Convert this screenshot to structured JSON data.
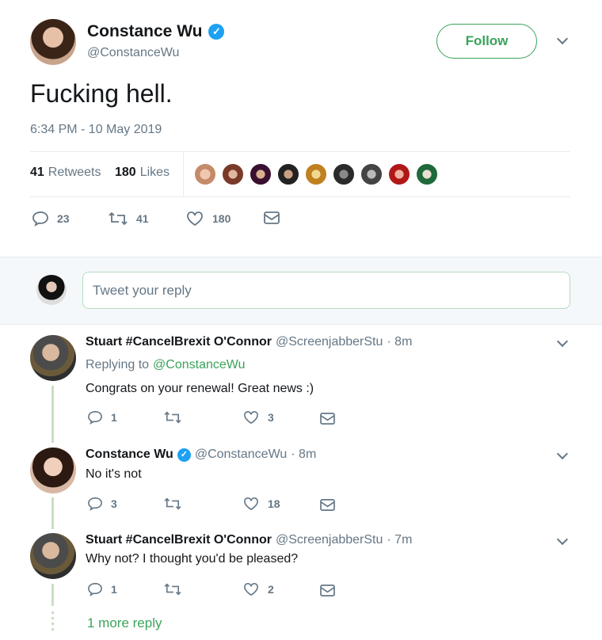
{
  "main_tweet": {
    "author_name": "Constance Wu",
    "author_handle": "@ConstanceWu",
    "follow_label": "Follow",
    "text": "Fucking hell.",
    "timestamp": "6:34 PM - 10 May 2019",
    "retweets_count": "41",
    "retweets_label": "Retweets",
    "likes_count": "180",
    "likes_label": "Likes",
    "actions": {
      "replies": "23",
      "retweets": "41",
      "likes": "180"
    }
  },
  "reply_box": {
    "placeholder": "Tweet your reply"
  },
  "replies": [
    {
      "name": "Stuart #CancelBrexit O'Connor",
      "handle": "@ScreenjabberStu",
      "time": "· 8m",
      "replying_prefix": "Replying to",
      "replying_to": "@ConstanceWu",
      "text": "Congrats on your renewal! Great news :)",
      "replies": "1",
      "likes": "3"
    },
    {
      "name": "Constance Wu",
      "handle": "@ConstanceWu",
      "time": "· 8m",
      "text": "No it's not",
      "replies": "3",
      "likes": "18"
    },
    {
      "name": "Stuart #CancelBrexit O'Connor",
      "handle": "@ScreenjabberStu",
      "time": "· 7m",
      "text": "Why not? I thought you'd be pleased?",
      "replies": "1",
      "likes": "2"
    }
  ],
  "more_replies": "1 more reply",
  "colors": {
    "accent_green": "#3aa35a",
    "verified_blue": "#1da1f2",
    "muted": "#657786"
  }
}
